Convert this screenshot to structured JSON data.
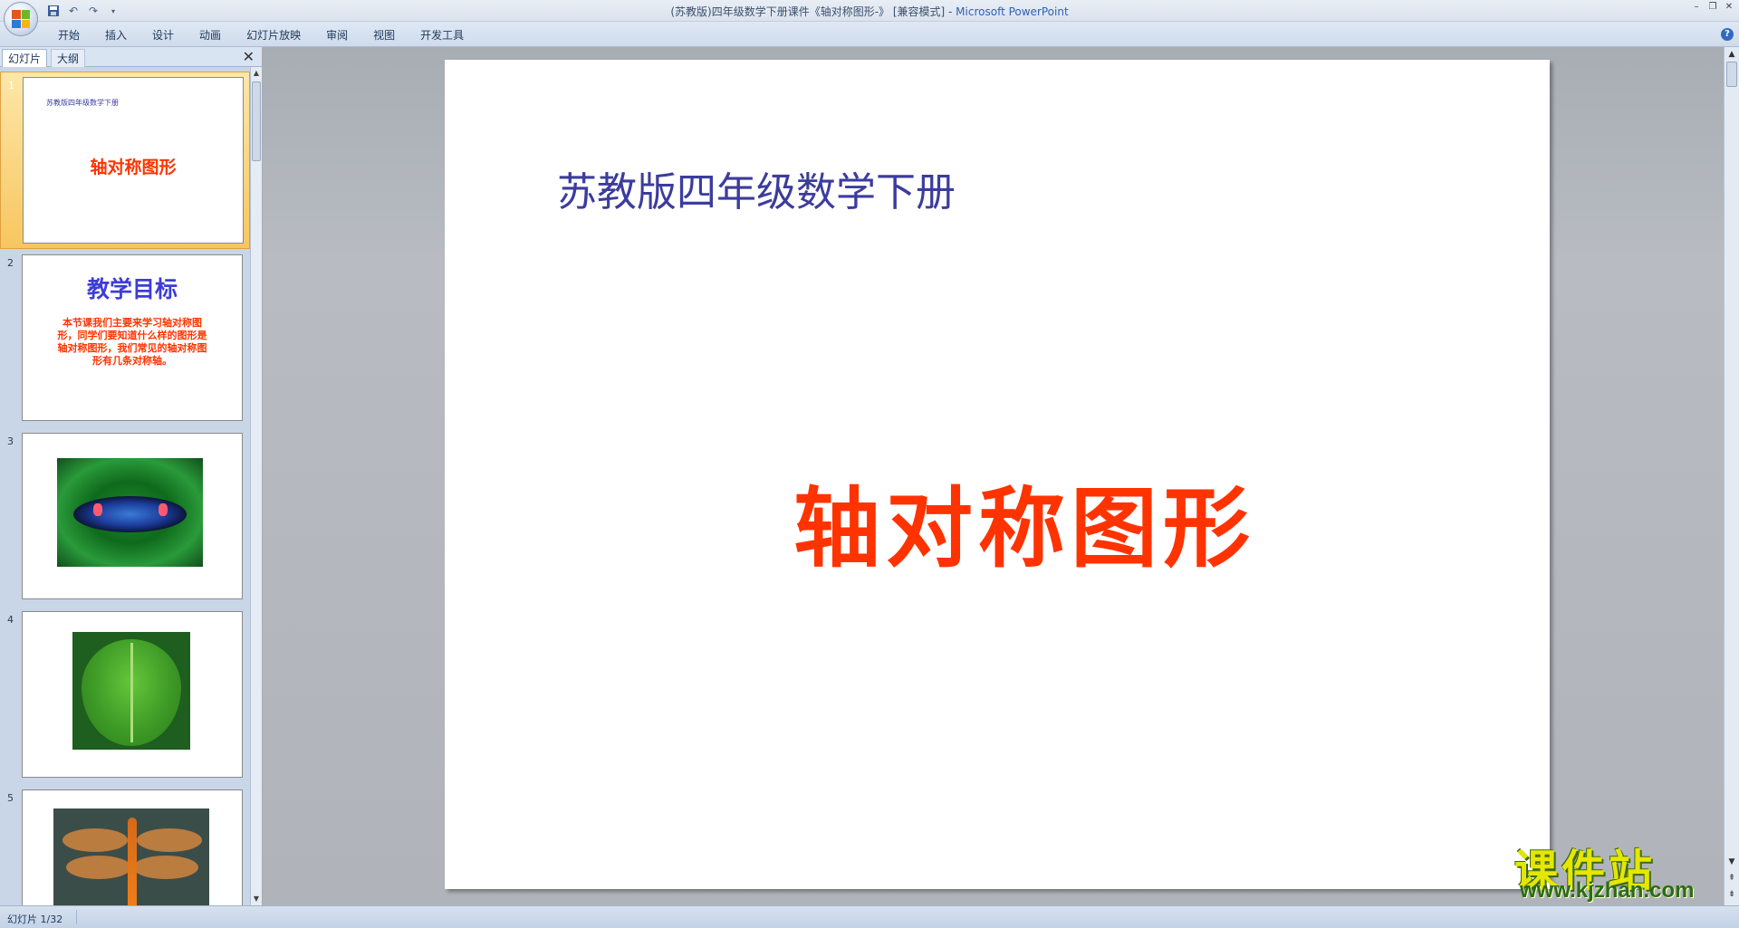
{
  "window": {
    "title": "(苏教版)四年级数学下册课件《轴对称图形-》 [兼容模式] - ",
    "app_name": "Microsoft PowerPoint"
  },
  "quick_access": [
    "save-icon",
    "undo-icon",
    "redo-icon",
    "customize-icon"
  ],
  "ribbon": {
    "tabs": [
      "开始",
      "插入",
      "设计",
      "动画",
      "幻灯片放映",
      "审阅",
      "视图",
      "开发工具"
    ]
  },
  "panel": {
    "tab_slides": "幻灯片",
    "tab_outline": "大纲"
  },
  "thumbnails": [
    {
      "num": "1",
      "subtitle": "苏教版四年级数学下册",
      "title": "轴对称图形"
    },
    {
      "num": "2",
      "title": "教学目标",
      "body": "本节课我们主要来学习轴对称图形，同学们要知道什么样的图形是轴对称图形，我们常见的轴对称图形有几条对称轴。"
    },
    {
      "num": "3",
      "image": "butterfly-photo"
    },
    {
      "num": "4",
      "image": "leaf-photo"
    },
    {
      "num": "5",
      "image": "dragonfly-photo"
    }
  ],
  "slide": {
    "subtitle": "苏教版四年级数学下册",
    "title": "轴对称图形"
  },
  "watermark": {
    "text": "课件站",
    "url": "www.kjzhan.com"
  },
  "status": {
    "slide_info": "幻灯片 1/32"
  },
  "colors": {
    "title_red": "#ff3300",
    "subtitle_blue": "#3c3c9e",
    "heading_blue": "#3d3dd6"
  }
}
